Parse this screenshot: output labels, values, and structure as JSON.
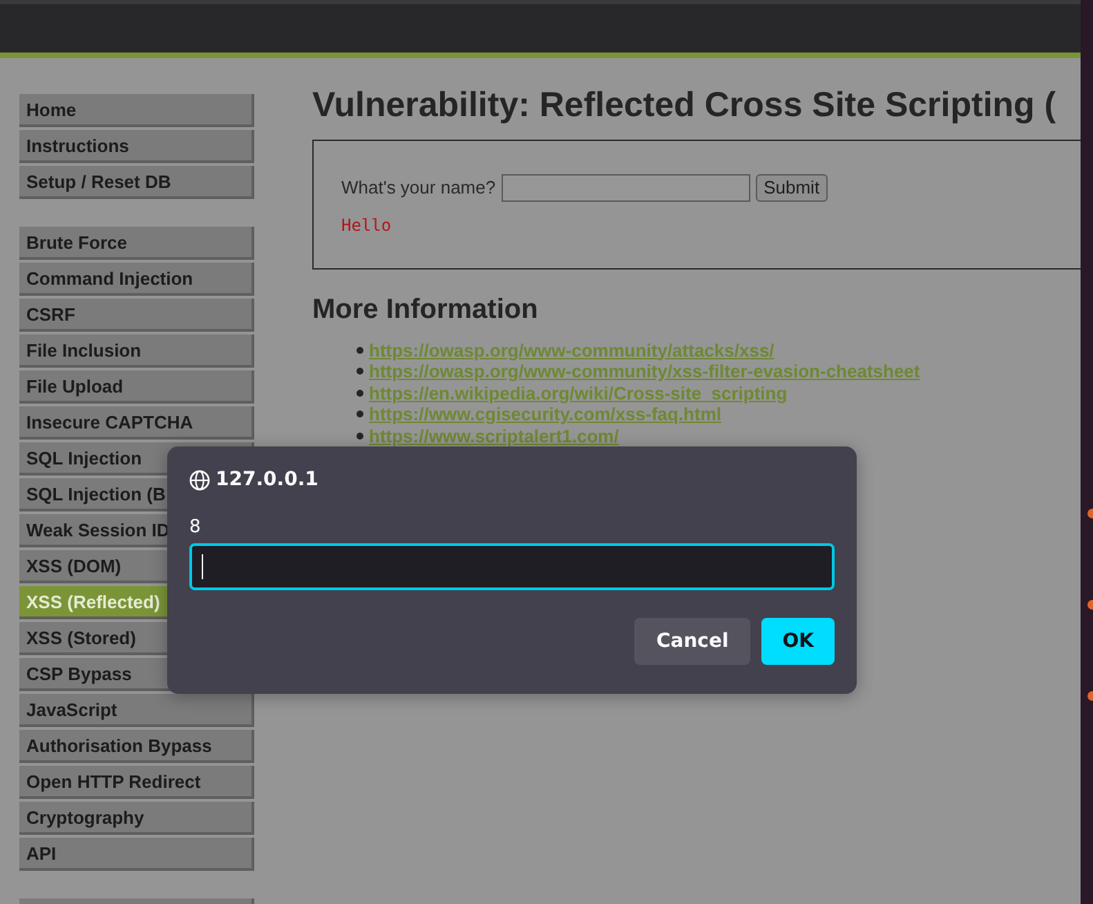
{
  "sidebar": {
    "groups": [
      {
        "items": [
          {
            "label": "Home",
            "selected": false
          },
          {
            "label": "Instructions",
            "selected": false
          },
          {
            "label": "Setup / Reset DB",
            "selected": false
          }
        ]
      },
      {
        "items": [
          {
            "label": "Brute Force",
            "selected": false
          },
          {
            "label": "Command Injection",
            "selected": false
          },
          {
            "label": "CSRF",
            "selected": false
          },
          {
            "label": "File Inclusion",
            "selected": false
          },
          {
            "label": "File Upload",
            "selected": false
          },
          {
            "label": "Insecure CAPTCHA",
            "selected": false
          },
          {
            "label": "SQL Injection",
            "selected": false
          },
          {
            "label": "SQL Injection (B",
            "selected": false
          },
          {
            "label": "Weak Session ID",
            "selected": false
          },
          {
            "label": "XSS (DOM)",
            "selected": false
          },
          {
            "label": "XSS (Reflected)",
            "selected": true
          },
          {
            "label": "XSS (Stored)",
            "selected": false
          },
          {
            "label": "CSP Bypass",
            "selected": false
          },
          {
            "label": "JavaScript",
            "selected": false
          },
          {
            "label": "Authorisation Bypass",
            "selected": false
          },
          {
            "label": "Open HTTP Redirect",
            "selected": false
          },
          {
            "label": "Cryptography",
            "selected": false
          },
          {
            "label": "API",
            "selected": false
          }
        ]
      }
    ]
  },
  "main": {
    "title": "Vulnerability: Reflected Cross Site Scripting (",
    "form": {
      "label": "What's your name?",
      "button": "Submit",
      "output": "Hello"
    },
    "more_info": {
      "heading": "More Information",
      "links": [
        "https://owasp.org/www-community/attacks/xss/",
        "https://owasp.org/www-community/xss-filter-evasion-cheatsheet",
        "https://en.wikipedia.org/wiki/Cross-site_scripting",
        "https://www.cgisecurity.com/xss-faq.html",
        "https://www.scriptalert1.com/"
      ]
    }
  },
  "dialog": {
    "origin": "127.0.0.1",
    "message": "8",
    "buttons": [
      {
        "label": "Cancel",
        "kind": "secondary"
      },
      {
        "label": "OK",
        "kind": "primary"
      }
    ]
  }
}
